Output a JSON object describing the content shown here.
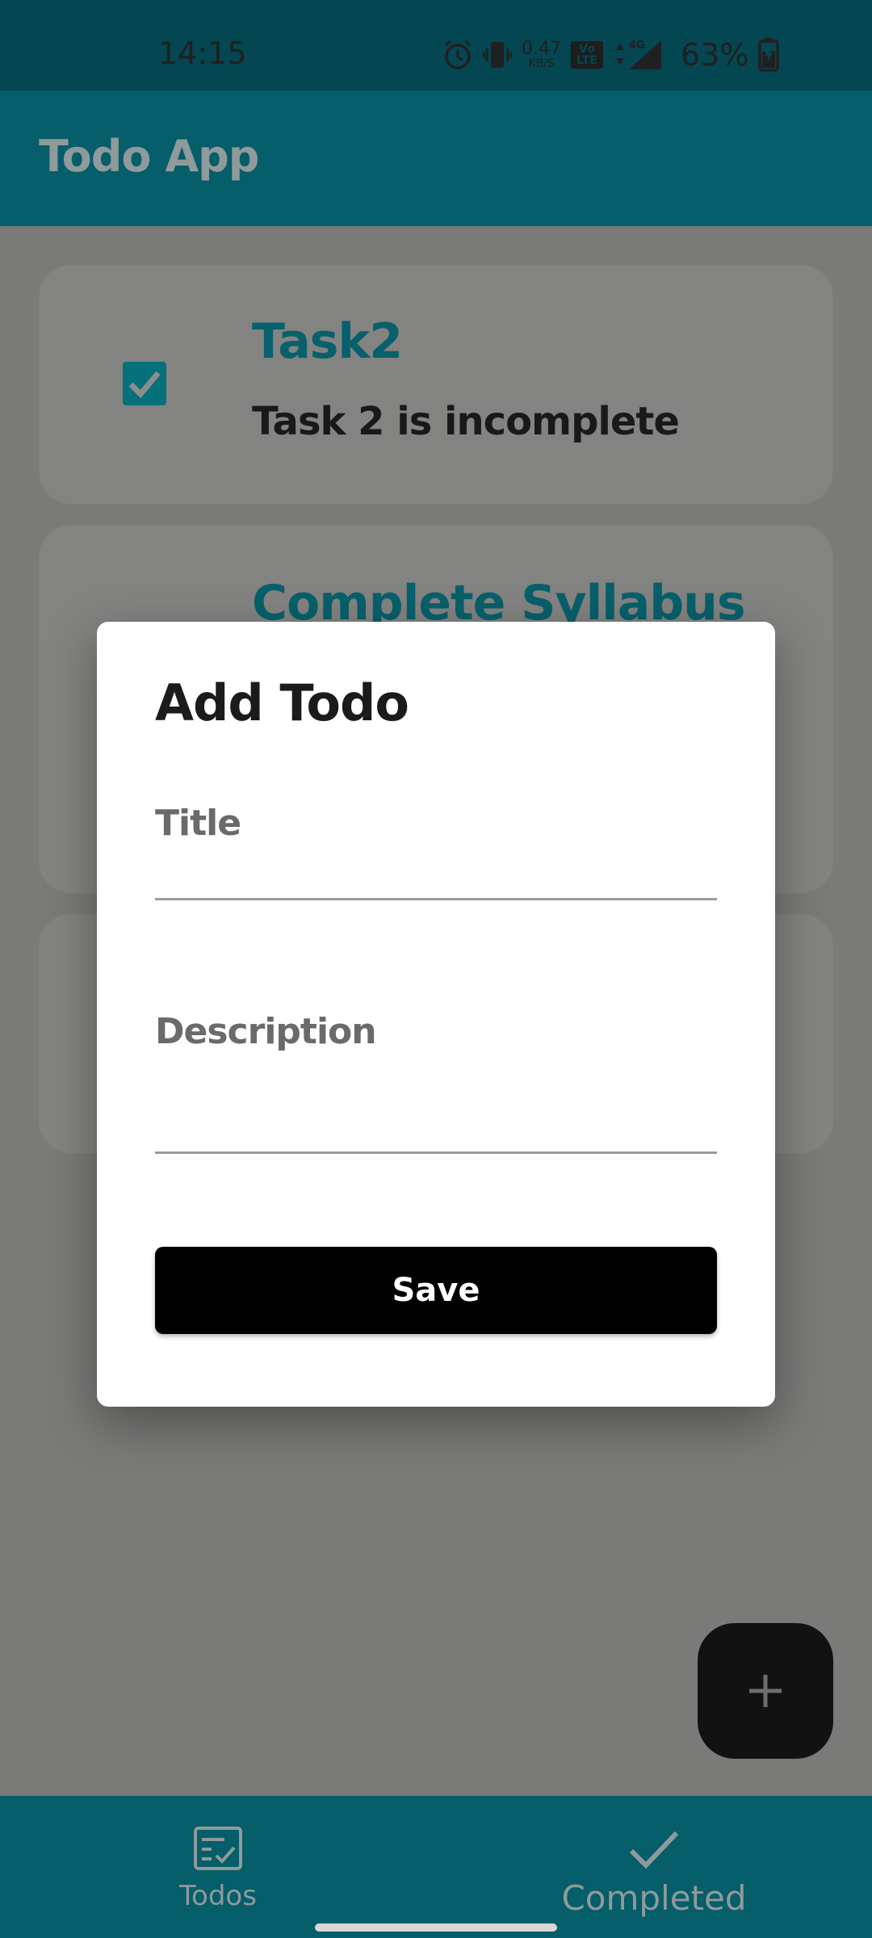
{
  "status_bar": {
    "time": "14:15",
    "net_speed_value": "0.47",
    "net_speed_unit": "KB/S",
    "volte_label": "Vo LTE",
    "network_label": "4G",
    "battery_percent": "63%",
    "icons": [
      "alarm-icon",
      "vibrate-icon",
      "signal-icon",
      "battery-charging-icon"
    ]
  },
  "app_bar": {
    "title": "Todo App"
  },
  "todos": [
    {
      "title": "Task2",
      "description": "Task 2 is incomplete",
      "checked": true
    },
    {
      "title": "Complete Syllabus",
      "description": "",
      "checked": false
    }
  ],
  "dialog": {
    "title": "Add Todo",
    "title_field": {
      "placeholder": "Title",
      "value": ""
    },
    "description_field": {
      "placeholder": "Description",
      "value": ""
    },
    "save_label": "Save"
  },
  "fab": {
    "icon": "plus-icon"
  },
  "bottom_nav": {
    "items": [
      {
        "label": "Todos",
        "icon": "todo-list-icon",
        "selected": false
      },
      {
        "label": "Completed",
        "icon": "check-icon",
        "selected": true
      }
    ]
  },
  "colors": {
    "primary": "#055e69",
    "accent_teal": "#07606b",
    "dialog_button": "#000000",
    "scrim_background": "#7a7a78"
  }
}
